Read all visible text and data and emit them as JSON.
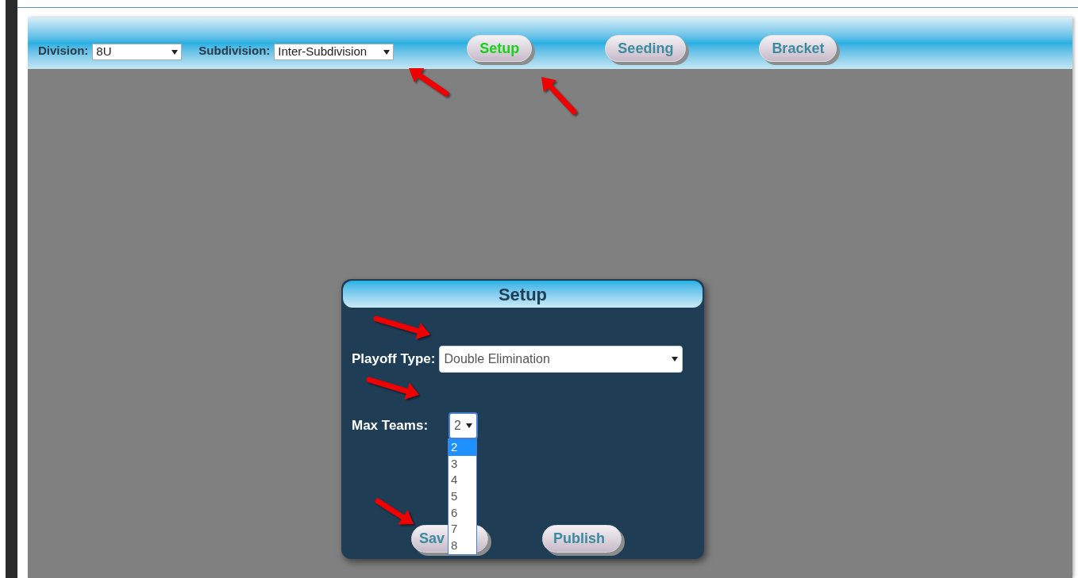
{
  "toolbar": {
    "division": {
      "label": "Division:",
      "value": "8U"
    },
    "subdivision": {
      "label": "Subdivision:",
      "value": "Inter-Subdivision"
    },
    "tabs": [
      {
        "label": "Setup",
        "selected": true
      },
      {
        "label": "Seeding",
        "selected": false
      },
      {
        "label": "Bracket",
        "selected": false
      }
    ]
  },
  "dialog": {
    "title": "Setup",
    "playoff_type": {
      "label": "Playoff Type:",
      "value": "Double Elimination"
    },
    "max_teams": {
      "label": "Max Teams:",
      "value": "2",
      "expanded": true,
      "options": [
        {
          "label": "2",
          "selected": true
        },
        {
          "label": "3",
          "selected": false
        },
        {
          "label": "4",
          "selected": false
        },
        {
          "label": "5",
          "selected": false
        },
        {
          "label": "6",
          "selected": false
        },
        {
          "label": "7",
          "selected": false
        },
        {
          "label": "8",
          "selected": false
        }
      ]
    },
    "buttons": [
      "Sav",
      "Publish"
    ]
  }
}
